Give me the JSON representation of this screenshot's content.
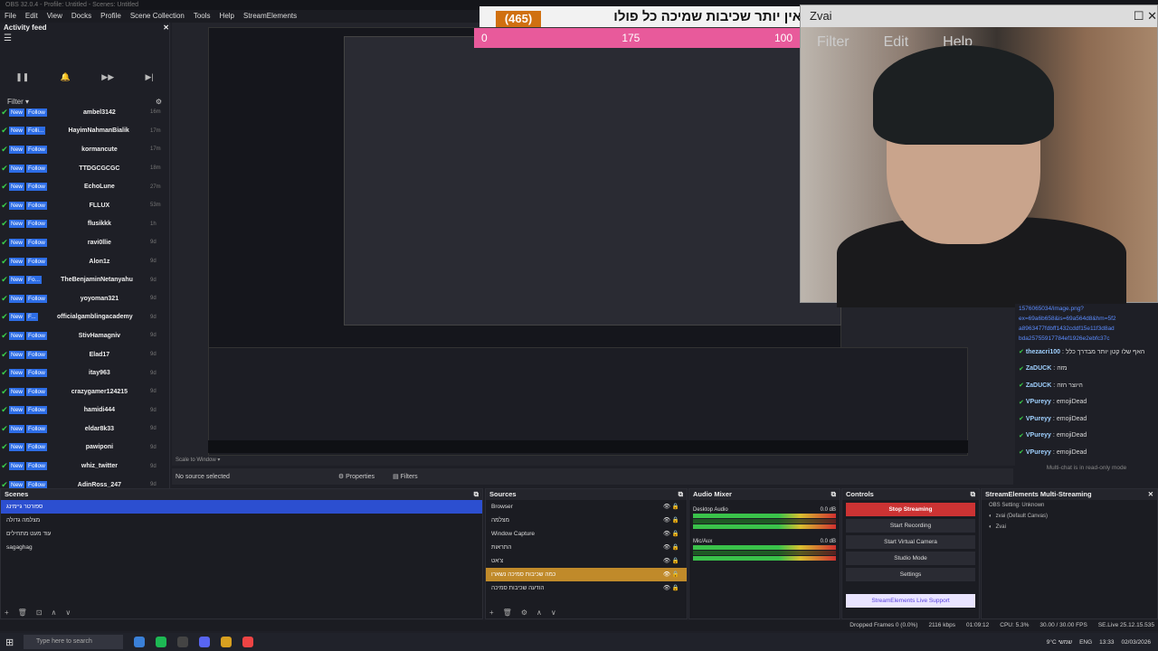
{
  "window_title": "OBS 32.0.4 - Profile: Untitled - Scenes: Untitled",
  "menu": [
    "File",
    "Edit",
    "View",
    "Docks",
    "Profile",
    "Scene Collection",
    "Tools",
    "Help",
    "StreamElements"
  ],
  "activity_feed": {
    "title": "Activity feed",
    "filter_label": "Filter",
    "items": [
      {
        "badge": "New",
        "type": "Follow",
        "user": "ambel3142",
        "age": "16m"
      },
      {
        "badge": "New",
        "type": "Folli...",
        "user": "HayimNahmanBialik",
        "age": "17m"
      },
      {
        "badge": "New",
        "type": "Follow",
        "user": "kormancute",
        "age": "17m"
      },
      {
        "badge": "New",
        "type": "Follow",
        "user": "TTDGCGCGC",
        "age": "18m"
      },
      {
        "badge": "New",
        "type": "Follow",
        "user": "EchoLune",
        "age": "27m"
      },
      {
        "badge": "New",
        "type": "Follow",
        "user": "FLLUX",
        "age": "53m"
      },
      {
        "badge": "New",
        "type": "Follow",
        "user": "flusikkk",
        "age": "1h"
      },
      {
        "badge": "New",
        "type": "Follow",
        "user": "ravi0llie",
        "age": "9d"
      },
      {
        "badge": "New",
        "type": "Follow",
        "user": "Alon1z",
        "age": "9d"
      },
      {
        "badge": "New",
        "type": "Fo...",
        "user": "TheBenjaminNetanyahu",
        "age": "9d"
      },
      {
        "badge": "New",
        "type": "Follow",
        "user": "yoyoman321",
        "age": "9d"
      },
      {
        "badge": "New",
        "type": "F...",
        "user": "officialgamblingacademy",
        "age": "9d"
      },
      {
        "badge": "New",
        "type": "Follow",
        "user": "StivHamagniv",
        "age": "9d"
      },
      {
        "badge": "New",
        "type": "Follow",
        "user": "Elad17",
        "age": "9d"
      },
      {
        "badge": "New",
        "type": "Follow",
        "user": "itay963",
        "age": "9d"
      },
      {
        "badge": "New",
        "type": "Follow",
        "user": "crazygamer124215",
        "age": "9d"
      },
      {
        "badge": "New",
        "type": "Follow",
        "user": "hamidi444",
        "age": "9d"
      },
      {
        "badge": "New",
        "type": "Follow",
        "user": "eldar8k33",
        "age": "9d"
      },
      {
        "badge": "New",
        "type": "Follow",
        "user": "pawiponi",
        "age": "9d"
      },
      {
        "badge": "New",
        "type": "Follow",
        "user": "whiz_twitter",
        "age": "9d"
      },
      {
        "badge": "New",
        "type": "Follow",
        "user": "AdinRoss_247",
        "age": "9d"
      }
    ]
  },
  "overlay": {
    "banner_text": "אין יותר שכיבות שמיכה כל פולו",
    "counter": "(465)",
    "bar_left": "0",
    "bar_mid": "175",
    "bar_right": "100"
  },
  "webcam": {
    "title": "Zvai",
    "menu": [
      "Filter",
      "Edit",
      "Help"
    ]
  },
  "chat": {
    "link_lines": [
      "1576065034/image.png?",
      "ex=69a6b658&is=69a564d8&hm=5f2",
      "a8963477fdbff1432cddf15e11f3d8ad",
      "bda25755917784ef1926e2ebfc37c"
    ],
    "messages": [
      {
        "user": "thezacri100",
        "text": "האף שלו קטן יותר מבדרך כלל"
      },
      {
        "user": "ZaDUCK",
        "text": "מזה"
      },
      {
        "user": "ZaDUCK",
        "text": "היוצר הזה"
      },
      {
        "user": "VPureyy",
        "text": "emojiDead"
      },
      {
        "user": "VPureyy",
        "text": "emojiDead"
      },
      {
        "user": "VPureyy",
        "text": "emojiDead"
      },
      {
        "user": "VPureyy",
        "text": "emojiDead"
      }
    ],
    "readonly_note": "Multi-chat is in read-only mode"
  },
  "preview_bar": {
    "scale_label": "Scale to Window",
    "no_source": "No source selected",
    "properties": "Properties",
    "filters": "Filters"
  },
  "scenes": {
    "title": "Scenes",
    "items": [
      "ספורטר גיימינג",
      "מצלמה גדולה",
      "עוד מעט מתחילים",
      "sagaghag"
    ]
  },
  "sources": {
    "title": "Sources",
    "items": [
      {
        "name": "Browser",
        "sel": false
      },
      {
        "name": "מצלמה",
        "sel": false
      },
      {
        "name": "Window Capture",
        "sel": false
      },
      {
        "name": "התראות",
        "sel": false
      },
      {
        "name": "צ'אט",
        "sel": false
      },
      {
        "name": "כמה שכיבות סמיכה נשארו",
        "sel": true
      },
      {
        "name": "הודעה שכיבות סמיכה",
        "sel": false
      }
    ]
  },
  "mixer": {
    "title": "Audio Mixer",
    "tracks": [
      {
        "name": "Desktop Audio",
        "db": "0.0 dB"
      },
      {
        "name": "Mic/Aux",
        "db": "0.0 dB"
      }
    ]
  },
  "controls": {
    "title": "Controls",
    "buttons": [
      "Stop Streaming",
      "Start Recording",
      "Start Virtual Camera",
      "Studio Mode",
      "Settings"
    ],
    "support": "StreamElements Live Support"
  },
  "multistream": {
    "title": "StreamElements Multi-Streaming",
    "status": "OBS Setting: Unknown",
    "items": [
      "zvai (Default Canvas)",
      "Zvai"
    ]
  },
  "status": {
    "dropped": "Dropped Frames 0 (0.0%)",
    "kbps": "2116 kbps",
    "time": "01:09:12",
    "cpu": "CPU: 5.3%",
    "fps": "30.00 / 30.00 FPS",
    "se": "SE.Live 25.12.15.535"
  },
  "taskbar": {
    "search_placeholder": "Type here to search",
    "weather": "9°C שמשי",
    "lang": "ENG",
    "clock": "13:33",
    "date": "02/03/2026"
  }
}
